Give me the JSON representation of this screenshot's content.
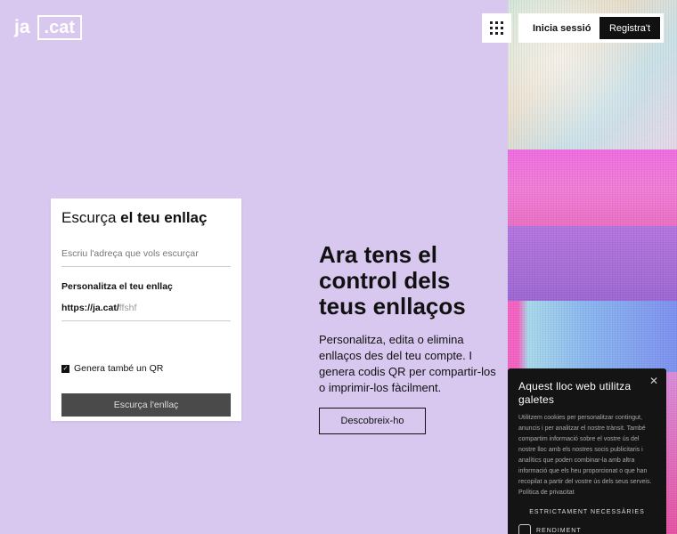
{
  "header": {
    "logo_left": "ja",
    "logo_box": ".cat",
    "login": "Inicia sessió",
    "register": "Registra't"
  },
  "card": {
    "title_plain": "Escurça ",
    "title_bold": "el teu enllaç",
    "url_placeholder": "Escriu l'adreça que vols escurçar",
    "custom_label": "Personalitza el teu enllaç",
    "custom_prefix": "https://ja.cat/",
    "custom_slug": "ffshf",
    "qr_label": "Genera també un QR",
    "qr_checked": true,
    "submit": "Escurça l'enllaç"
  },
  "hero": {
    "title": "Ara tens el control dels teus enllaços",
    "text": "Personalitza, edita o elimina enllaços des del teu compte. I genera codis QR per compartir-los o imprimir-los fàcilment.",
    "cta": "Descobreix-ho"
  },
  "cookie": {
    "title": "Aquest lloc web utilitza galetes",
    "body": "Utilitzem cookies per personalitzar contingut, anuncis i per analitzar el nostre trànsit. També compartim informació sobre el vostre ús del nostre lloc amb els nostres socis publicitaris i analítics que poden combinar-la amb altra informació que els heu proporcionat o que han recopilat a partir del vostre ús dels seus serveis. Política de privacitat",
    "option_necessary": "ESTRICTAMENT NECESSÀRIES",
    "option_performance": "RENDIMENT",
    "close_icon": "close-icon"
  },
  "colors": {
    "background": "#d8c8ef",
    "button_dark": "#111111",
    "submit_disabled": "#4a4a4a"
  }
}
